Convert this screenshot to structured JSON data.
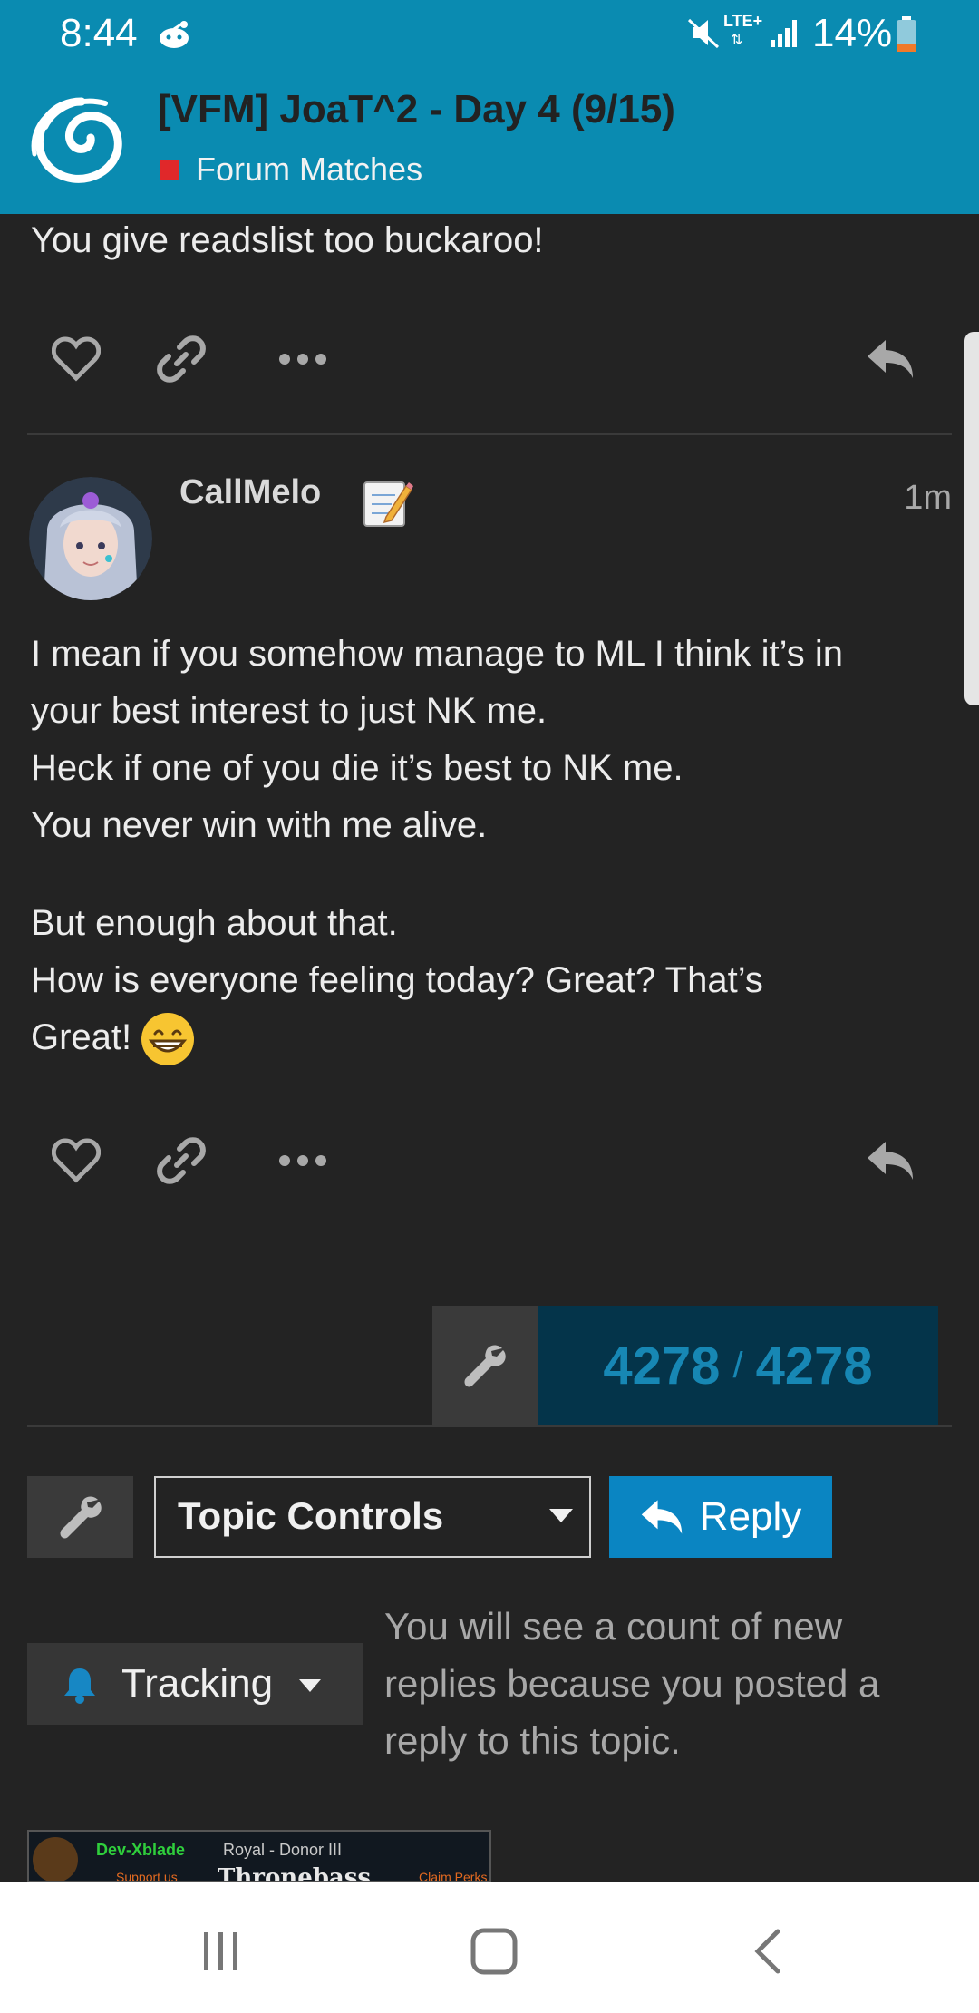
{
  "status_bar": {
    "time": "8:44",
    "network": "LTE+",
    "battery": "14%"
  },
  "header": {
    "title": "[VFM] JoaT^2 - Day 4 (9/15)",
    "category": "Forum Matches",
    "category_color": "#e0282a",
    "background_color": "#0a8bb1"
  },
  "previous_post": {
    "text": "You give readslist too buckaroo!"
  },
  "post": {
    "username": "CallMelo",
    "time": "1m",
    "paragraph_1": [
      "I mean if you somehow manage to ML I think it’s in",
      "your best interest to just NK me.",
      "Heck if one of you die it’s best to NK me.",
      "You never win with me alive."
    ],
    "paragraph_2": [
      "But enough about that.",
      "How is everyone feeling today? Great? That’s",
      "Great!"
    ]
  },
  "progress": {
    "current": "4278",
    "separator": "/",
    "total": "4278"
  },
  "footer": {
    "topic_controls_label": "Topic Controls",
    "reply_label": "Reply",
    "tracking_label": "Tracking",
    "tracking_description": "You will see a count of new replies because you posted a reply to this topic."
  },
  "signature": {
    "name": "Dev-Xblade",
    "rank": "Royal - Donor III",
    "support": "Support us",
    "brand": "Thronebass",
    "claim": "Claim Perks"
  },
  "icons": {
    "like": "heart-icon",
    "share": "link-icon",
    "more": "more-icon",
    "reply": "reply-icon",
    "wrench": "wrench-icon",
    "bell": "bell-icon"
  }
}
